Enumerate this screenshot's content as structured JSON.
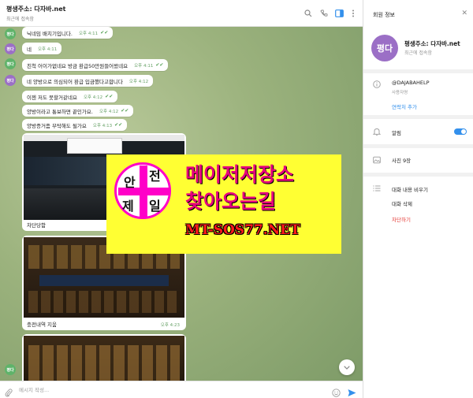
{
  "chat": {
    "title": "평생주소: 다자바.net",
    "status": "최근에 접속함",
    "avatar_label": "평다",
    "messages": [
      {
        "text": "닉네임 배치기입니다.",
        "time": "오후 4:11"
      },
      {
        "text": "네",
        "time": "오후 4:11"
      },
      {
        "text": "친척 어이가없네요 방금 환급50만원들어왔네요",
        "time": "오후 4:11"
      },
      {
        "text": "네 양방으로 의심되어 환급 입금했다고합니다",
        "time": "오후 4:12"
      },
      {
        "text": "이젠 저도 못할거같네요",
        "time": "오후 4:12"
      },
      {
        "text": "양방이라고 통보하면 끝인가요.",
        "time": "오후 4:12"
      },
      {
        "text": "양방증거좀 부탁해도 될가요",
        "time": "오후 4:13"
      }
    ],
    "media": [
      {
        "caption": "차단당함",
        "time": ""
      },
      {
        "caption": "충전내역 지움",
        "time": "오후 4:23"
      }
    ],
    "composer_placeholder": "메시지 작성..."
  },
  "info": {
    "title": "회원 정보",
    "name": "평생주소: 다자바.net",
    "status": "최근에 접속함",
    "username": "@DAJABAHELP",
    "username_label": "사용자명",
    "add_contact": "연락처 추가",
    "notifications": "알림",
    "notifications_on": true,
    "photos": "사진 9장",
    "clear_history": "대화 내용 비우기",
    "delete_chat": "대화 삭제",
    "block": "차단하기"
  },
  "ad": {
    "badge_chars": [
      "안",
      "전",
      "제",
      "일"
    ],
    "line1": "메이저저장소",
    "line2": "찾아오는길",
    "url": "MT-SOS77.NET"
  },
  "colors": {
    "accent": "#3390ec",
    "avatar": "#9b6fc6",
    "block": "#e53935",
    "ad_bg": "#ffff33",
    "ad_pink": "#e6007e"
  }
}
